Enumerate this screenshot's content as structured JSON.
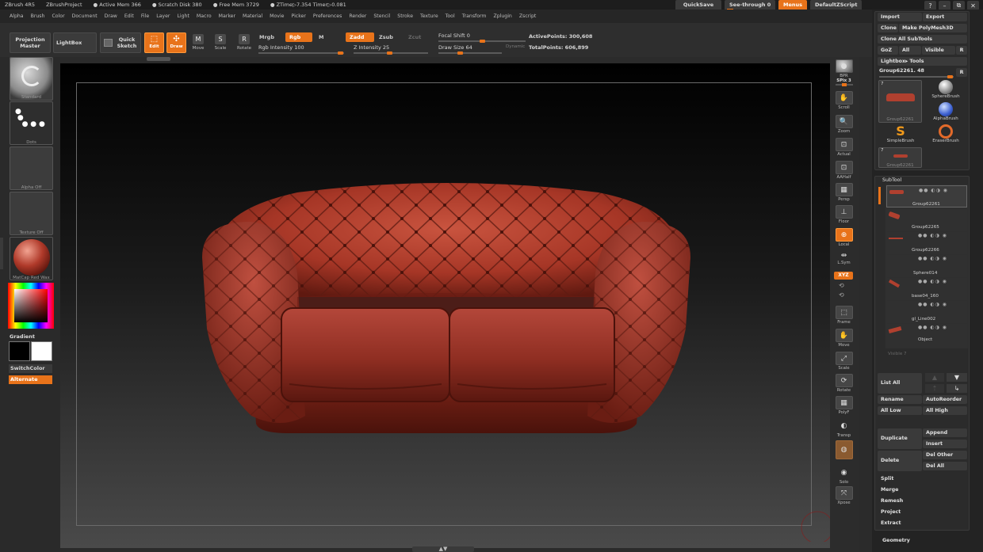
{
  "titlebar": {
    "app": "ZBrush 4R5",
    "project": "ZBrushProject",
    "active_mem": "● Active Mem 366",
    "scratch": "● Scratch Disk 380",
    "free_mem": "● Free Mem 3729",
    "ztime": "● ZTime▷7.354 Timer▷0.081"
  },
  "top_buttons": {
    "quicksave": "QuickSave",
    "seethrough": "See-through  0",
    "menus": "Menus",
    "defaultscript": "DefaultZScript"
  },
  "window_controls": {
    "help": "?",
    "minimize": "–",
    "restore": "▢",
    "maximize": "⧉",
    "close": "✕"
  },
  "menu": [
    "Alpha",
    "Brush",
    "Color",
    "Document",
    "Draw",
    "Edit",
    "File",
    "Layer",
    "Light",
    "Macro",
    "Marker",
    "Material",
    "Movie",
    "Picker",
    "Preferences",
    "Render",
    "Stencil",
    "Stroke",
    "Texture",
    "Tool",
    "Transform",
    "Zplugin",
    "Zscript"
  ],
  "toolbar": {
    "projection_master": "Projection Master",
    "lightbox": "LightBox",
    "quick_sketch": "Quick Sketch",
    "edit": "Edit",
    "draw": "Draw",
    "move": "Move",
    "scale": "Scale",
    "rotate": "Rotate",
    "mrgb": "Mrgb",
    "rgb": "Rgb",
    "m": "M",
    "rgb_intensity": "Rgb  Intensity 100",
    "zadd": "Zadd",
    "zsub": "Zsub",
    "zcut": "Zcut",
    "z_intensity": "Z  Intensity 25",
    "focal_shift": "Focal  Shift 0",
    "draw_size": "Draw  Size 64",
    "dynamic": "Dynamic",
    "active_points": "ActivePoints: 300,608",
    "total_points": "TotalPoints: 606,899",
    "rgb_intensity_value": 100,
    "z_intensity_value": 25,
    "focal_shift_value": 0,
    "draw_size_value": 64
  },
  "left_tray": {
    "standard": "Standard",
    "dots": "Dots",
    "alpha_off": "Alpha  Off",
    "texture_off": "Texture  Off",
    "matcap": "MatCap  Red  Wax",
    "gradient": "Gradient",
    "switch_color": "SwitchColor",
    "alternate": "Alternate"
  },
  "right_shelf": [
    {
      "name": "bpr-button",
      "label": "BPR",
      "glyph": "●"
    },
    {
      "name": "spix-label",
      "label": "SPix 3",
      "glyph": ""
    },
    {
      "name": "scroll-button",
      "label": "Scroll",
      "glyph": "✋"
    },
    {
      "name": "zoom-button",
      "label": "Zoom",
      "glyph": "🔍"
    },
    {
      "name": "actual-button",
      "label": "Actual",
      "glyph": "⊡"
    },
    {
      "name": "aahalf-button",
      "label": "AAHalf",
      "glyph": "⊡"
    },
    {
      "name": "persp-button",
      "label": "Persp",
      "glyph": "▦"
    },
    {
      "name": "floor-button",
      "label": "Floor",
      "glyph": "⊥"
    },
    {
      "name": "local-button",
      "label": "Local",
      "glyph": "⊕"
    },
    {
      "name": "lsym-button",
      "label": "L.Sym",
      "glyph": "⇹"
    },
    {
      "name": "xyz-button",
      "label": "XYZ",
      "glyph": ""
    },
    {
      "name": "frame-button",
      "label": "Frame",
      "glyph": "⬚"
    },
    {
      "name": "move-view-button",
      "label": "Move",
      "glyph": "✋"
    },
    {
      "name": "scale-view-button",
      "label": "Scale",
      "glyph": "⤢"
    },
    {
      "name": "rotate-view-button",
      "label": "Rotate",
      "glyph": "⟳"
    },
    {
      "name": "polyf-button",
      "label": "PolyF",
      "glyph": "▦"
    },
    {
      "name": "transp-button",
      "label": "Transp",
      "glyph": "◐"
    },
    {
      "name": "ghost-button",
      "label": "",
      "glyph": "◍"
    },
    {
      "name": "solo-button",
      "label": "Solo",
      "glyph": "◉"
    },
    {
      "name": "xpose-button",
      "label": "Xpose",
      "glyph": "⤧"
    }
  ],
  "tool_panel": {
    "import": "Import",
    "export": "Export",
    "clone": "Clone",
    "make_polymesh": "Make PolyMesh3D",
    "clone_all_subtools": "Clone  All  SubTools",
    "goz": "GoZ",
    "all": "All",
    "visible": "Visible",
    "r": "R",
    "lightbox_tools": "Lightbox▸ Tools",
    "current_tool": "Group62261. 48",
    "current_tool_count": "7",
    "brushes": [
      {
        "name": "Group62261",
        "kind": "current"
      },
      {
        "name": "SphereBrush",
        "kind": "sphere"
      },
      {
        "name": "AlphaBrush",
        "kind": "alpha"
      },
      {
        "name": "SimpleBrush",
        "kind": "simple"
      },
      {
        "name": "EraserBrush",
        "kind": "eraser"
      },
      {
        "name": "Group62261",
        "kind": "small"
      }
    ],
    "thumb2_count": "7"
  },
  "subtool": {
    "title": "SubTool",
    "items": [
      "Group62261",
      "Group62265",
      "Group62266",
      "Sphere014",
      "base04_160",
      "gl_Line002",
      "Object"
    ],
    "visible_footer": "Visible 7",
    "list_all": "List  All",
    "rename": "Rename",
    "auto_reorder": "AutoReorder",
    "all_low": "All  Low",
    "all_high": "All  High",
    "duplicate": "Duplicate",
    "append": "Append",
    "insert": "Insert",
    "delete": "Delete",
    "del_other": "Del  Other",
    "del_all": "Del  All",
    "split": "Split",
    "merge": "Merge",
    "remesh": "Remesh",
    "project": "Project",
    "extract": "Extract",
    "geometry": "Geometry"
  },
  "colors": {
    "accent": "#e8731a",
    "sofa": "#a9382a",
    "sofa_dark": "#6b1c14",
    "sofa_light": "#d46a55"
  }
}
